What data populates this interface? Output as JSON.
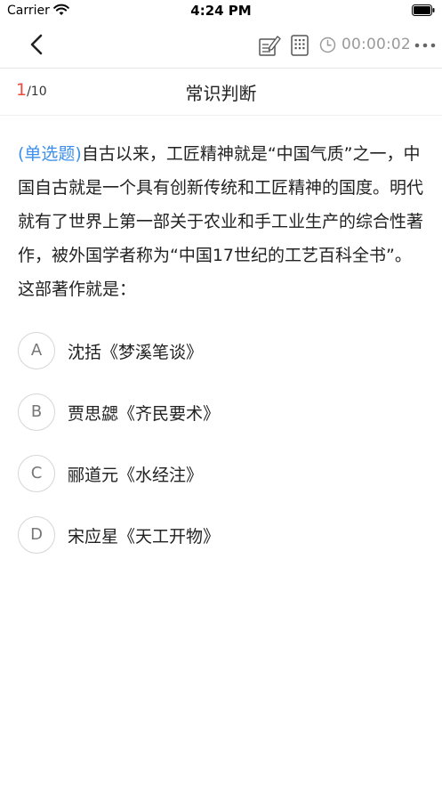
{
  "status_bar": {
    "carrier": "Carrier",
    "time": "4:24 PM"
  },
  "nav": {
    "back_icon": "chevron-left-icon",
    "edit_icon": "edit-note-icon",
    "answer_sheet_icon": "grid-card-icon",
    "timer_icon": "clock-icon",
    "timer": "00:00:02",
    "more_icon": "more-dots-icon"
  },
  "progress": {
    "current": "1",
    "total": "/10"
  },
  "section_title": "常识判断",
  "question": {
    "type": "(单选题)",
    "text": "自古以来，工匠精神就是“中国气质”之一，中国自古就是一个具有创新传统和工匠精神的国度。明代就有了世界上第一部关于农业和手工业生产的综合性著作，被外国学者称为“中国17世纪的工艺百科全书”。这部著作就是："
  },
  "options": [
    {
      "letter": "A",
      "text": "沈括《梦溪笔谈》"
    },
    {
      "letter": "B",
      "text": "贾思勰《齐民要术》"
    },
    {
      "letter": "C",
      "text": "郦道元《水经注》"
    },
    {
      "letter": "D",
      "text": "宋应星《天工开物》"
    }
  ],
  "colors": {
    "accent_red": "#e74c3c",
    "question_type_blue": "#3d8fe8",
    "timer_gray": "#9a9a9a"
  }
}
